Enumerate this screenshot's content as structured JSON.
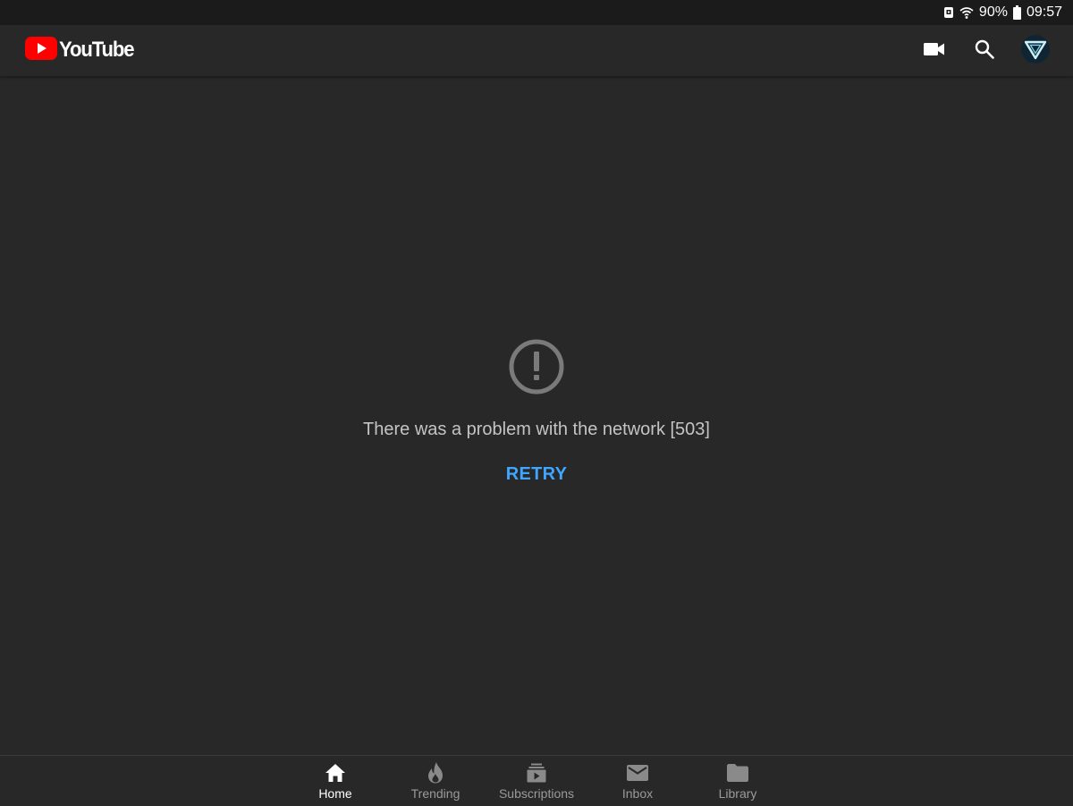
{
  "status_bar": {
    "battery_percent": "90%",
    "time": "09:57"
  },
  "app_bar": {
    "logo_text": "YouTube",
    "brand_color": "#ff0000",
    "actions": [
      {
        "icon": "video-camera-icon"
      },
      {
        "icon": "search-icon"
      },
      {
        "icon": "account-avatar"
      }
    ]
  },
  "error": {
    "icon": "alert-circle-icon",
    "message": "There was a problem with the network [503]",
    "retry_label": "RETRY",
    "accent_color": "#3ea6ff"
  },
  "bottom_nav": {
    "items": [
      {
        "label": "Home",
        "icon": "home-icon",
        "active": true
      },
      {
        "label": "Trending",
        "icon": "flame-icon",
        "active": false
      },
      {
        "label": "Subscriptions",
        "icon": "subscriptions-icon",
        "active": false
      },
      {
        "label": "Inbox",
        "icon": "mail-icon",
        "active": false
      },
      {
        "label": "Library",
        "icon": "folder-icon",
        "active": false
      }
    ]
  }
}
